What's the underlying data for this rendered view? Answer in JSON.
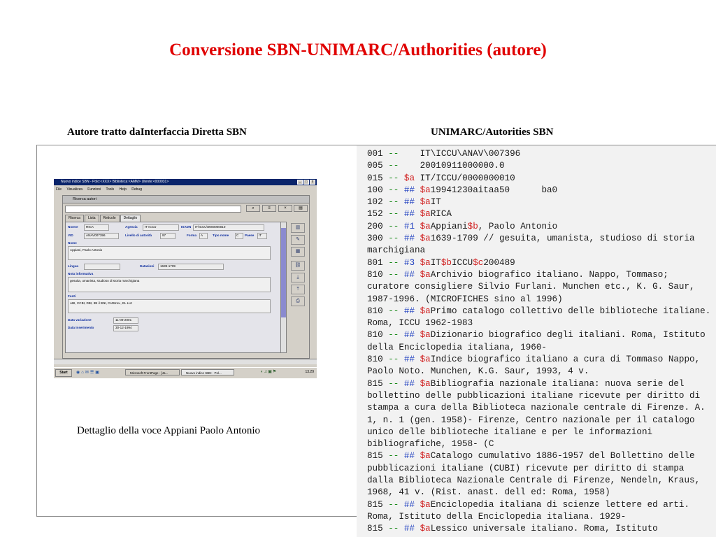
{
  "slide": {
    "title": "Conversione SBN-UNIMARC/Authorities (autore)",
    "left_header": "Autore  tratto daInterfaccia Diretta SBN",
    "right_header": "UNIMARC/Autorities  SBN",
    "caption": "Dettaglio della voce Appiani Paolo Antonio",
    "accent_color": "#e00000"
  },
  "screenshot": {
    "window_title": "Nuovo indice SBN - Polo:<XXX> Biblioteca:<AMM> Utente:<000031>",
    "window_buttons": [
      "_",
      "□",
      "x"
    ],
    "menu": [
      "File",
      "Visualizza",
      "Funzioni",
      "Tools",
      "Help",
      "Debug"
    ],
    "inner_title": "Ricerca autori",
    "toolbar_icons": [
      "search-icon",
      "list-icon",
      "close-icon",
      "print-icon"
    ],
    "tabs": [
      "Ricerca",
      "Lista",
      "Reticolo",
      "Dettaglio"
    ],
    "active_tab": "Dettaglio",
    "fields": {
      "norme_label": "Norme",
      "norme_value": "RICA",
      "agenzia_label": "Agenzia",
      "agenzia_value": "IT ICCU",
      "isadn_label": "ISADN",
      "isadn_value": "IT\\ICCU\\0000000010",
      "vid_label": "VID",
      "vid_value": "ANAV007396",
      "livello_label": "Livello di autorità",
      "livello_value": "97",
      "forma_label": "Forma",
      "forma_value": "A",
      "tipo_label": "Tipo nome",
      "tipo_value": "C",
      "paese_label": "Paese",
      "paese_value": "IT",
      "nome_label": "Nome",
      "nome_value": "Appiani, Paolo Antonio",
      "lingua_label": "Lingua",
      "datazioni_label": "Datazioni",
      "datazioni_value": "1639-1709",
      "nota_label": "Nota informativa",
      "nota_value": "gesuita, umanista, studioso di storia marchigiana",
      "fonti_label": "Fonti",
      "fonti_value": "ABI, CCBI, DBI, IBI il BNI, CUBIrev., EL LUI",
      "data_var_label": "Data variazione",
      "data_var_value": "11-09-2001",
      "data_ins_label": "Data inserimento",
      "data_ins_value": "30-12-1994"
    },
    "taskbar": {
      "start": "Start",
      "task1": "Microsoft FrontPage - [Ja...",
      "task2": "Nuovo indice SBN - Pol...",
      "clock": "13.29"
    }
  },
  "marc_lines": [
    {
      "tag": "001",
      "sep": "--",
      "ind": "",
      "text": "   IT\\ICCU\\ANAV\\007396"
    },
    {
      "tag": "005",
      "sep": "--",
      "ind": "",
      "text": "   20010911000000.0"
    },
    {
      "tag": "015",
      "sep": "--",
      "ind": "",
      "sub": "$a",
      "text": " IT/ICCU/0000000010"
    },
    {
      "tag": "100",
      "sep": "--",
      "ind": "##",
      "sub": "$a",
      "text": "19941230aitaa50      ba0"
    },
    {
      "tag": "102",
      "sep": "--",
      "ind": "##",
      "sub": "$a",
      "text": "IT"
    },
    {
      "tag": "152",
      "sep": "--",
      "ind": "##",
      "sub": "$a",
      "text": "RICA"
    },
    {
      "tag": "200",
      "sep": "--",
      "ind": "#1",
      "sub": "$a",
      "text": "Appiani",
      "sub2": "$b",
      "text2": ", Paolo Antonio"
    },
    {
      "tag": "300",
      "sep": "--",
      "ind": "##",
      "sub": "$a",
      "text": "1639-1709 // gesuita, umanista, studioso di storia marchigiana"
    },
    {
      "tag": "801",
      "sep": "--",
      "ind": "#3",
      "sub": "$a",
      "text": "IT",
      "sub2": "$b",
      "text2": "ICCU",
      "sub3": "$c",
      "text3": "200489"
    },
    {
      "tag": "810",
      "sep": "--",
      "ind": "##",
      "sub": "$a",
      "text": "Archivio biografico italiano. Nappo, Tommaso; curatore consigliere Silvio Furlani. Munchen etc., K. G. Saur, 1987-1996. (MICROFICHES sino al 1996)"
    },
    {
      "tag": "810",
      "sep": "--",
      "ind": "##",
      "sub": "$a",
      "text": "Primo catalogo collettivo delle biblioteche italiane. Roma, ICCU 1962-1983"
    },
    {
      "tag": "810",
      "sep": "--",
      "ind": "##",
      "sub": "$a",
      "text": "Dizionario biografico degli italiani. Roma, Istituto della Enciclopedia italiana, 1960-"
    },
    {
      "tag": "810",
      "sep": "--",
      "ind": "##",
      "sub": "$a",
      "text": "Indice biografico italiano a cura di Tommaso Nappo, Paolo Noto. Munchen, K.G. Saur, 1993, 4 v."
    },
    {
      "tag": "815",
      "sep": "--",
      "ind": "##",
      "sub": "$a",
      "text": "Bibliografia nazionale italiana: nuova serie del bollettino delle pubblicazioni italiane ricevute per diritto di stampa a cura della Biblioteca nazionale centrale di Firenze. A. 1, n. 1 (gen. 1958)- Firenze, Centro nazionale per il catalogo unico delle biblioteche italiane e per le informazioni bibliografiche, 1958- (C"
    },
    {
      "tag": "815",
      "sep": "--",
      "ind": "##",
      "sub": "$a",
      "text": "Catalogo cumulativo 1886-1957 del Bollettino delle pubblicazioni italiane (CUBI) ricevute per diritto di stampa dalla Biblioteca Nazionale Centrale di Firenze, Nendeln, Kraus, 1968, 41 v. (Rist. anast. dell ed: Roma, 1958)"
    },
    {
      "tag": "815",
      "sep": "--",
      "ind": "##",
      "sub": "$a",
      "text": "Enciclopedia italiana di scienze lettere ed arti. Roma, Istituto della Enciclopedia italiana. 1929-"
    },
    {
      "tag": "815",
      "sep": "--",
      "ind": "##",
      "sub": "$a",
      "text": "Lessico universale italiano. Roma, Istituto"
    }
  ]
}
